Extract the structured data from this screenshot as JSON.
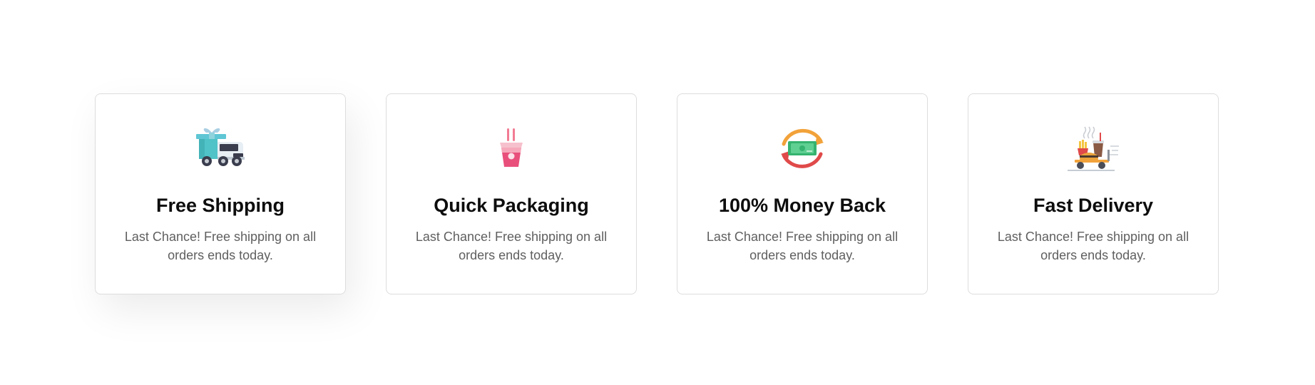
{
  "features": [
    {
      "title": "Free Shipping",
      "description": "Last Chance! Free shipping on all orders ends today.",
      "icon": "delivery-truck-icon"
    },
    {
      "title": "Quick Packaging",
      "description": "Last Chance! Free shipping on all orders ends today.",
      "icon": "takeaway-box-icon"
    },
    {
      "title": "100% Money Back",
      "description": "Last Chance! Free shipping on all orders ends today.",
      "icon": "money-back-icon"
    },
    {
      "title": "Fast Delivery",
      "description": "Last Chance! Free shipping on all orders ends today.",
      "icon": "food-cart-icon"
    }
  ],
  "colors": {
    "card_border": "#dddddd",
    "title_text": "#0d0d0d",
    "description_text": "#5f5f5f",
    "truck_teal": "#4fc3c7",
    "box_pink": "#e94f7b",
    "arrow_orange": "#f2a23a",
    "arrow_red": "#e04a4a",
    "cash_green": "#35b36f"
  }
}
